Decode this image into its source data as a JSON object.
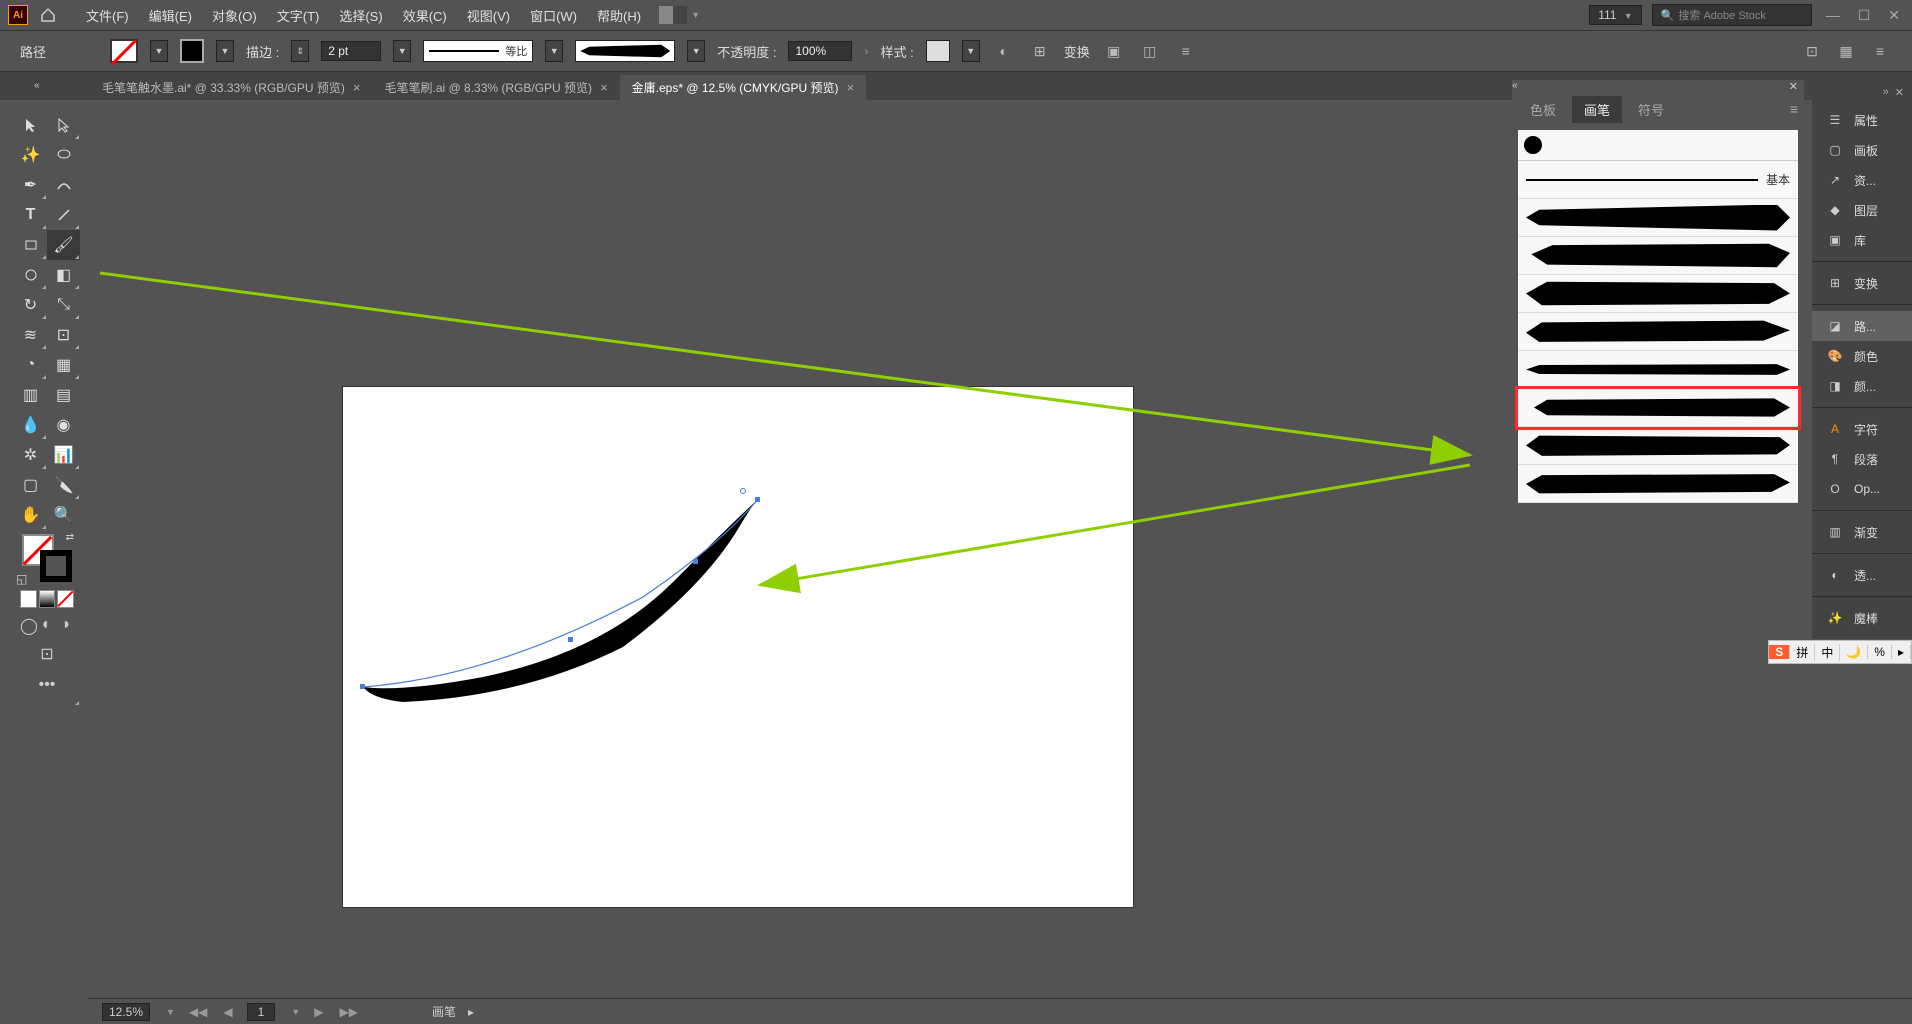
{
  "menubar": {
    "app_abbr": "Ai",
    "items": [
      "文件(F)",
      "编辑(E)",
      "对象(O)",
      "文字(T)",
      "选择(S)",
      "效果(C)",
      "视图(V)",
      "窗口(W)",
      "帮助(H)"
    ],
    "zoom_display": "111",
    "search_placeholder": "搜索 Adobe Stock"
  },
  "controlbar": {
    "label_path": "路径",
    "label_stroke": "描边 :",
    "stroke_weight": "2 pt",
    "profile_label": "等比",
    "label_opacity": "不透明度 :",
    "opacity": "100%",
    "label_style": "样式 :",
    "label_transform": "变换"
  },
  "tabs": [
    {
      "label": "毛笔笔触水墨.ai* @ 33.33% (RGB/GPU 预览)",
      "active": false
    },
    {
      "label": "毛笔笔刷.ai @ 8.33% (RGB/GPU 预览)",
      "active": false
    },
    {
      "label": "金庸.eps* @ 12.5% (CMYK/GPU 预览)",
      "active": true
    }
  ],
  "brushes_panel": {
    "tabs": [
      "色板",
      "画笔",
      "符号"
    ],
    "active_tab": 1,
    "basic_label": "基本"
  },
  "right_dock": {
    "items": [
      {
        "label": "属性",
        "icon": "sliders"
      },
      {
        "label": "画板",
        "icon": "artboard"
      },
      {
        "label": "资...",
        "icon": "share"
      },
      {
        "label": "图层",
        "icon": "layers"
      },
      {
        "label": "库",
        "icon": "library"
      },
      {
        "label": "变换",
        "icon": "transform"
      },
      {
        "label": "路...",
        "icon": "pathfinder"
      },
      {
        "label": "颜色",
        "icon": "palette"
      },
      {
        "label": "颜...",
        "icon": "color-guide"
      },
      {
        "label": "字符",
        "icon": "character"
      },
      {
        "label": "段落",
        "icon": "paragraph"
      },
      {
        "label": "Op...",
        "icon": "opentype"
      },
      {
        "label": "渐变",
        "icon": "gradient"
      },
      {
        "label": "透...",
        "icon": "transparency"
      },
      {
        "label": "魔棒",
        "icon": "magic-wand"
      }
    ]
  },
  "ime": {
    "segs": [
      "拼",
      "中",
      "🌙",
      "%",
      "▸"
    ]
  },
  "statusbar": {
    "zoom": "12.5%",
    "artboard_num": "1",
    "tool_hint": "画笔"
  }
}
